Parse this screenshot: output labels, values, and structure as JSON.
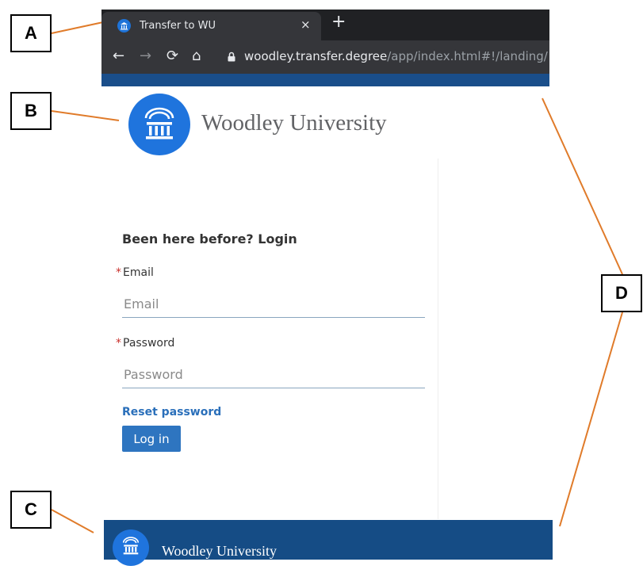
{
  "callouts": {
    "a": "A",
    "b": "B",
    "c": "C",
    "d": "D"
  },
  "browser": {
    "tab_title": "Transfer to WU",
    "tab_close": "×",
    "new_tab": "+",
    "url_host": "woodley.transfer.degree",
    "url_path": "/app/index.html#!/landing/",
    "icons": [
      "back-arrow-icon",
      "forward-arrow-icon",
      "reload-icon",
      "home-icon",
      "lock-icon"
    ]
  },
  "header": {
    "university_name": "Woodley University"
  },
  "login": {
    "heading": "Been here before? Login",
    "required_mark": "*",
    "email_label": "Email",
    "email_placeholder": "Email",
    "password_label": "Password",
    "password_placeholder": "Password",
    "reset_link": "Reset password",
    "login_button": "Log in"
  },
  "footer": {
    "university_name": "Woodley University"
  },
  "colors": {
    "brand_blue": "#1f74dd",
    "nav_bar_blue": "#154c85",
    "button_blue": "#2e75c0",
    "callout_line": "#e07b2a",
    "required_red": "#c9302c"
  }
}
